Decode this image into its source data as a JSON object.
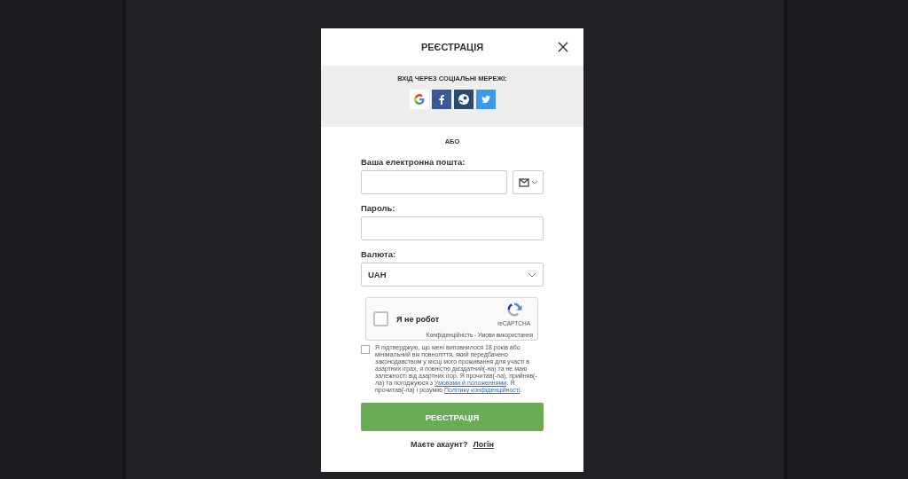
{
  "modal": {
    "title": "РЕЄСТРАЦІЯ",
    "social": {
      "heading": "ВХІД ЧЕРЕЗ СОЦІАЛЬНІ МЕРЕЖІ:",
      "buttons": [
        {
          "kind": "google"
        },
        {
          "kind": "facebook"
        },
        {
          "kind": "steam"
        },
        {
          "kind": "twitter"
        }
      ]
    },
    "separator": "АБО",
    "email": {
      "label": "Ваша електронна пошта:"
    },
    "password": {
      "label": "Пароль:"
    },
    "currency": {
      "label": "Валюта:",
      "value": "UAH"
    },
    "captcha": {
      "label": "Я не робот",
      "checked": false,
      "brand": "reCAPTCHA",
      "terms": "Конфіденційність - Умови використання"
    },
    "consent": {
      "checked": false,
      "text_1": "Я підтверджую, що мені виповнилося 18 років або мінімальний вік повноліття, який передбачено законодавством у місці мого проживання для участі в азартних іграх, я повністю дієздатний(-на) та не маю залежності від азартних ігор. Я прочитав(-ла), прийняв(-ла) та погоджуюся з",
      "link_1": "Умовами й положеннями",
      "text_2": ". Я прочитав(-ла) і розумію",
      "link_2": "Політику конфіденційності",
      "text_3": "."
    },
    "submit": "РЕЄСТРАЦІЯ",
    "account": {
      "prompt": "Маєте акаунт?",
      "link": "Логін"
    }
  }
}
